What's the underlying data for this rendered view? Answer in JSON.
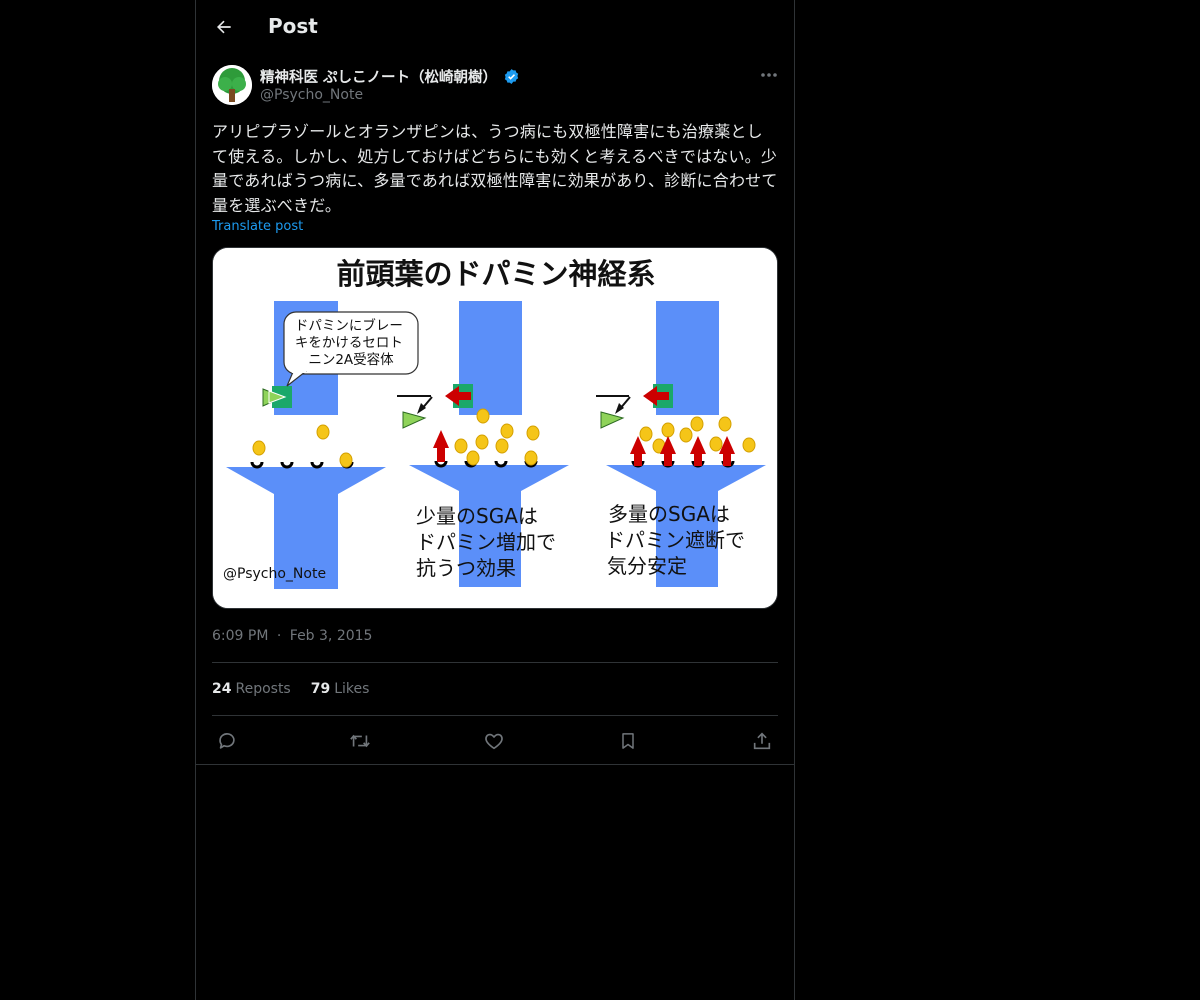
{
  "header": {
    "title": "Post"
  },
  "author": {
    "display_name": "精神科医 ぷしこノート（松崎朝樹）",
    "handle": "@Psycho_Note",
    "verified": true
  },
  "post": {
    "text": "アリピプラゾールとオランザピンは、うつ病にも双極性障害にも治療薬として使える。しかし、処方しておけばどちらにも効くと考えるべきではない。少量であればうつ病に、多量であれば双極性障害に効果があり、診断に合わせて量を選ぶべきだ。",
    "translate_label": "Translate post",
    "time": "6:09 PM",
    "separator": "·",
    "date": "Feb 3, 2015"
  },
  "image": {
    "title": "前頭葉のドパミン神経系",
    "callout": [
      "ドパミンにブレー",
      "キをかけるセロト",
      "ニン2A受容体"
    ],
    "watermark": "@Psycho_Note",
    "panel2": [
      "少量のSGAは",
      "ドパミン増加で",
      "抗うつ効果"
    ],
    "panel3": [
      "多量のSGAは",
      "ドパミン遮断で",
      "気分安定"
    ]
  },
  "stats": {
    "reposts_count": "24",
    "reposts_label": "Reposts",
    "likes_count": "79",
    "likes_label": "Likes"
  },
  "colors": {
    "background": "#000000",
    "text": "#e7e9ea",
    "muted": "#71767b",
    "link": "#1d9bf0",
    "neuron_blue": "#5b8ff9",
    "dopamine_yellow": "#f5c518",
    "receptor_red": "#cc0000",
    "receptor_green": "#1ba86a"
  },
  "icons": [
    "back-arrow-icon",
    "verified-badge-icon",
    "more-icon",
    "reply-icon",
    "repost-icon",
    "like-icon",
    "bookmark-icon",
    "share-icon"
  ]
}
